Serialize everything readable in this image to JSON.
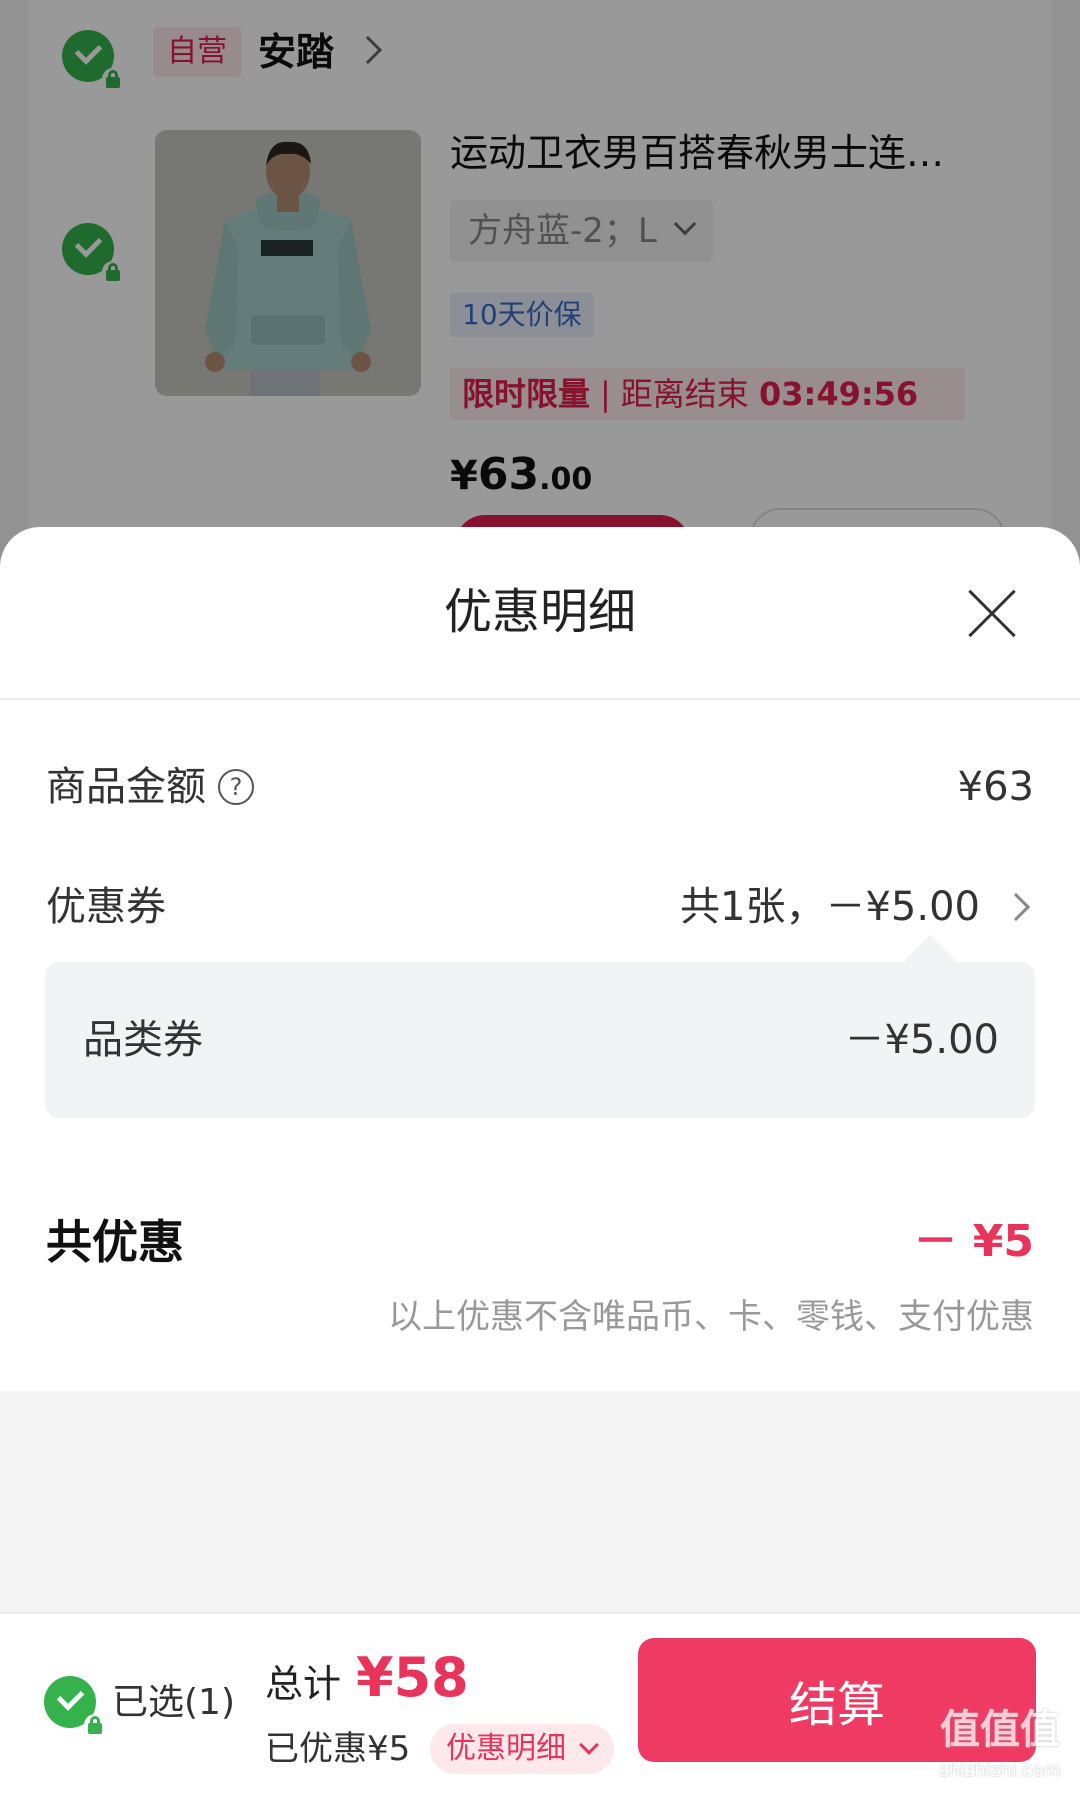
{
  "cart": {
    "self_operated_tag": "自营",
    "shop_name": "安踏",
    "product": {
      "title": "运动卫衣男百搭春秋男士连…",
      "sku": "方舟蓝-2；L",
      "price_protect_tag": "10天价保",
      "flash_sale_label": "限时限量",
      "flash_sale_divider": "|",
      "countdown_label": "距离结束",
      "countdown": "03:49:56",
      "price_symbol": "¥",
      "price_integer": "63",
      "price_decimal": ".00"
    }
  },
  "sheet": {
    "title": "优惠明细",
    "goods_amount_label": "商品金额",
    "help_symbol": "?",
    "goods_amount_value": "¥63",
    "coupon_label": "优惠券",
    "coupon_value": "共1张，－¥5.00",
    "category_coupon_label": "品类券",
    "category_coupon_value": "－¥5.00",
    "total_discount_label": "共优惠",
    "total_discount_value": "－ ¥5",
    "note": "以上优惠不含唯品币、卡、零钱、支付优惠"
  },
  "bottom_bar": {
    "selected_label": "已选(1)",
    "total_label": "总计",
    "total_amount": "¥58",
    "saved_label": "已优惠¥5",
    "detail_pill_label": "优惠明细",
    "checkout_label": "结算"
  },
  "watermark": {
    "main": "值值值",
    "url": "zhizhizhi.com"
  },
  "colors": {
    "accent": "#e8345a",
    "check_green": "#35b24b",
    "checkout_button": "#ef3a63"
  }
}
